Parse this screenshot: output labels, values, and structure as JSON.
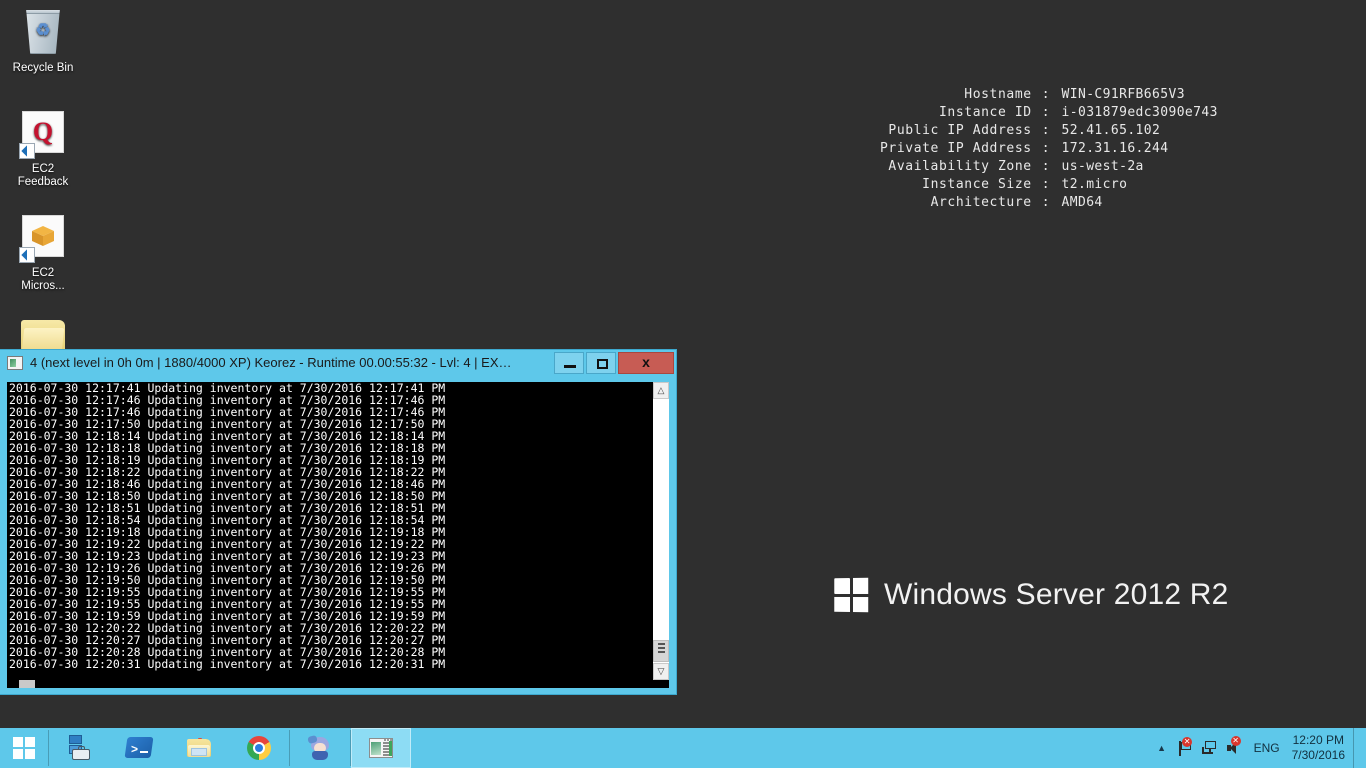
{
  "desktop": {
    "background_color": "#2f2f2f",
    "icons": [
      {
        "name": "recycle-bin",
        "label": "Recycle Bin",
        "icon": "recycle-bin-icon",
        "shortcut": false
      },
      {
        "name": "ec2-feedback",
        "label": "EC2\nFeedback",
        "label_line1": "EC2",
        "label_line2": "Feedback",
        "icon": "q-letter-icon",
        "shortcut": true
      },
      {
        "name": "ec2-microsite",
        "label": "EC2\nMicros...",
        "label_line1": "EC2",
        "label_line2": "Micros...",
        "icon": "orange-box-icon",
        "shortcut": true
      },
      {
        "name": "folder",
        "label": "",
        "icon": "folder-icon",
        "shortcut": false
      }
    ]
  },
  "instance_info": {
    "rows": [
      {
        "label": "Hostname",
        "sep": ":",
        "value": "WIN-C91RFB665V3"
      },
      {
        "label": "Instance ID",
        "sep": ":",
        "value": "i-031879edc3090e743"
      },
      {
        "label": "Public IP Address",
        "sep": ":",
        "value": "52.41.65.102"
      },
      {
        "label": "Private IP Address",
        "sep": ":",
        "value": "172.31.16.244"
      },
      {
        "label": "Availability Zone",
        "sep": ":",
        "value": "us-west-2a"
      },
      {
        "label": "Instance Size",
        "sep": ":",
        "value": "t2.micro"
      },
      {
        "label": "Architecture",
        "sep": ":",
        "value": "AMD64"
      }
    ]
  },
  "branding": {
    "text": "Windows Server 2012 R2",
    "logo": "windows-logo-icon"
  },
  "console_window": {
    "title": "4 (next level in 0h 0m | 1880/4000 XP) Keorez - Runtime 00.00:55:32 - Lvl: 4 | EX…",
    "title_bar_color": "#5EC8EA",
    "icon": "console-window-icon",
    "buttons": {
      "minimize": "–",
      "maximize": "□",
      "close": "x"
    },
    "scrollbar": {
      "up_arrow": "⌃",
      "down_arrow": "⌄"
    },
    "lines": [
      "2016-07-30 12:17:41 Updating inventory at 7/30/2016 12:17:41 PM",
      "2016-07-30 12:17:46 Updating inventory at 7/30/2016 12:17:46 PM",
      "2016-07-30 12:17:46 Updating inventory at 7/30/2016 12:17:46 PM",
      "2016-07-30 12:17:50 Updating inventory at 7/30/2016 12:17:50 PM",
      "2016-07-30 12:18:14 Updating inventory at 7/30/2016 12:18:14 PM",
      "2016-07-30 12:18:18 Updating inventory at 7/30/2016 12:18:18 PM",
      "2016-07-30 12:18:19 Updating inventory at 7/30/2016 12:18:19 PM",
      "2016-07-30 12:18:22 Updating inventory at 7/30/2016 12:18:22 PM",
      "2016-07-30 12:18:46 Updating inventory at 7/30/2016 12:18:46 PM",
      "2016-07-30 12:18:50 Updating inventory at 7/30/2016 12:18:50 PM",
      "2016-07-30 12:18:51 Updating inventory at 7/30/2016 12:18:51 PM",
      "2016-07-30 12:18:54 Updating inventory at 7/30/2016 12:18:54 PM",
      "2016-07-30 12:19:18 Updating inventory at 7/30/2016 12:19:18 PM",
      "2016-07-30 12:19:22 Updating inventory at 7/30/2016 12:19:22 PM",
      "2016-07-30 12:19:23 Updating inventory at 7/30/2016 12:19:23 PM",
      "2016-07-30 12:19:26 Updating inventory at 7/30/2016 12:19:26 PM",
      "2016-07-30 12:19:50 Updating inventory at 7/30/2016 12:19:50 PM",
      "2016-07-30 12:19:55 Updating inventory at 7/30/2016 12:19:55 PM",
      "2016-07-30 12:19:55 Updating inventory at 7/30/2016 12:19:55 PM",
      "2016-07-30 12:19:59 Updating inventory at 7/30/2016 12:19:59 PM",
      "2016-07-30 12:20:22 Updating inventory at 7/30/2016 12:20:22 PM",
      "2016-07-30 12:20:27 Updating inventory at 7/30/2016 12:20:27 PM",
      "2016-07-30 12:20:28 Updating inventory at 7/30/2016 12:20:28 PM",
      "2016-07-30 12:20:31 Updating inventory at 7/30/2016 12:20:31 PM"
    ]
  },
  "taskbar": {
    "background_color": "#5EC8EA",
    "start": {
      "label": "Start",
      "icon": "windows-start-icon"
    },
    "items": [
      {
        "name": "server-manager",
        "icon": "server-manager-icon",
        "active": false
      },
      {
        "name": "powershell",
        "icon": "powershell-icon",
        "active": false
      },
      {
        "name": "file-explorer",
        "icon": "file-explorer-icon",
        "active": false
      },
      {
        "name": "google-chrome",
        "icon": "chrome-icon",
        "active": false
      },
      {
        "name": "anime-app",
        "icon": "anime-character-icon",
        "active": false
      },
      {
        "name": "console-app",
        "icon": "console-app-icon",
        "active": true
      }
    ],
    "tray": {
      "chevron": "▲",
      "icons": [
        {
          "name": "action-center-flag",
          "icon": "flag-icon",
          "badge": "x"
        },
        {
          "name": "network",
          "icon": "network-icon",
          "badge": ""
        },
        {
          "name": "volume",
          "icon": "speaker-muted-icon",
          "badge": "x"
        }
      ],
      "language": "ENG",
      "clock_time": "12:20 PM",
      "clock_date": "7/30/2016"
    }
  }
}
